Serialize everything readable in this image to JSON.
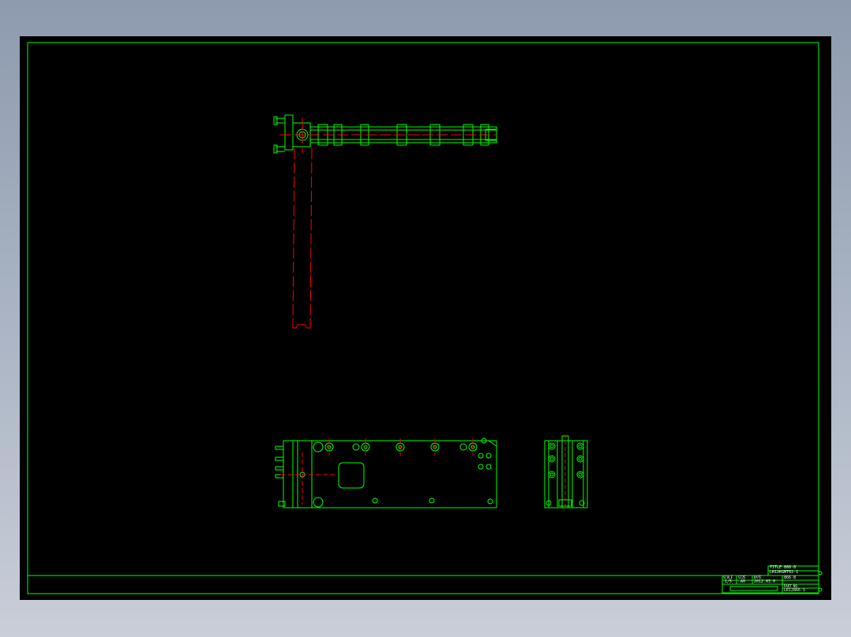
{
  "colors": {
    "background_outer": "#9aa5b8",
    "model_space": "#000000",
    "frame": "#00ff00",
    "geometry": "#00ff00",
    "hidden_lines": "#ff0000",
    "title_text": "#ffffff"
  },
  "title_block": {
    "title_row": "TITLE 866-8",
    "drawing_row": "LR12KGMT62-1",
    "scale_label": "SCALE",
    "scale_value": "1/5",
    "size_label": "SIZE",
    "size_value": "A0",
    "date_label": "DATE",
    "date_value": "2012.03.0",
    "part_label": "866-8",
    "part_no_label": "PART NO.",
    "part_no_value": "LR12866-5"
  },
  "views": [
    {
      "name": "top-view"
    },
    {
      "name": "front-view"
    },
    {
      "name": "side-view"
    }
  ]
}
